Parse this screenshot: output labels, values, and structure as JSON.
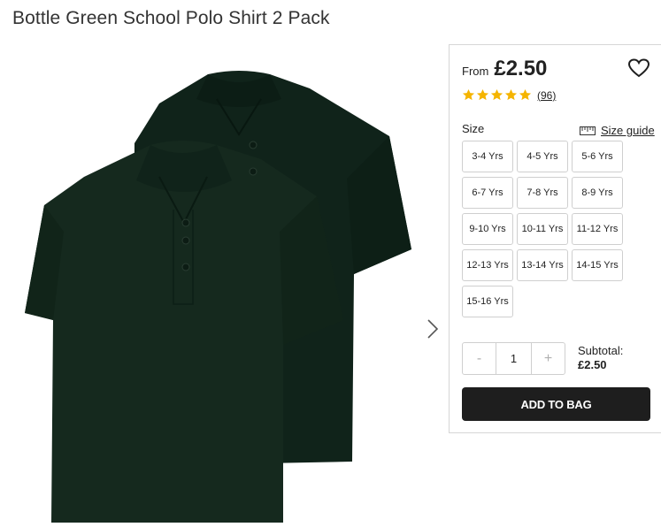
{
  "product": {
    "title": "Bottle Green School Polo Shirt 2 Pack",
    "image": "bottle-green-polo-shirts-2-pack",
    "price_prefix": "From",
    "price": "£2.50",
    "rating": 5,
    "review_count": "(96)"
  },
  "size_section": {
    "label": "Size",
    "guide_label": "Size guide",
    "sizes": [
      "3-4 Yrs",
      "4-5 Yrs",
      "5-6 Yrs",
      "6-7 Yrs",
      "7-8 Yrs",
      "8-9 Yrs",
      "9-10 Yrs",
      "10-11 Yrs",
      "11-12 Yrs",
      "12-13 Yrs",
      "13-14 Yrs",
      "14-15 Yrs",
      "15-16 Yrs"
    ]
  },
  "quantity": {
    "minus": "-",
    "value": "1",
    "plus": "+"
  },
  "subtotal": {
    "label": "Subtotal:",
    "value": "£2.50"
  },
  "actions": {
    "add_to_bag": "ADD TO BAG"
  },
  "colors": {
    "shirt_green": "#14271c",
    "star_yellow": "#f5b400",
    "button_dark": "#1e1e1e"
  }
}
